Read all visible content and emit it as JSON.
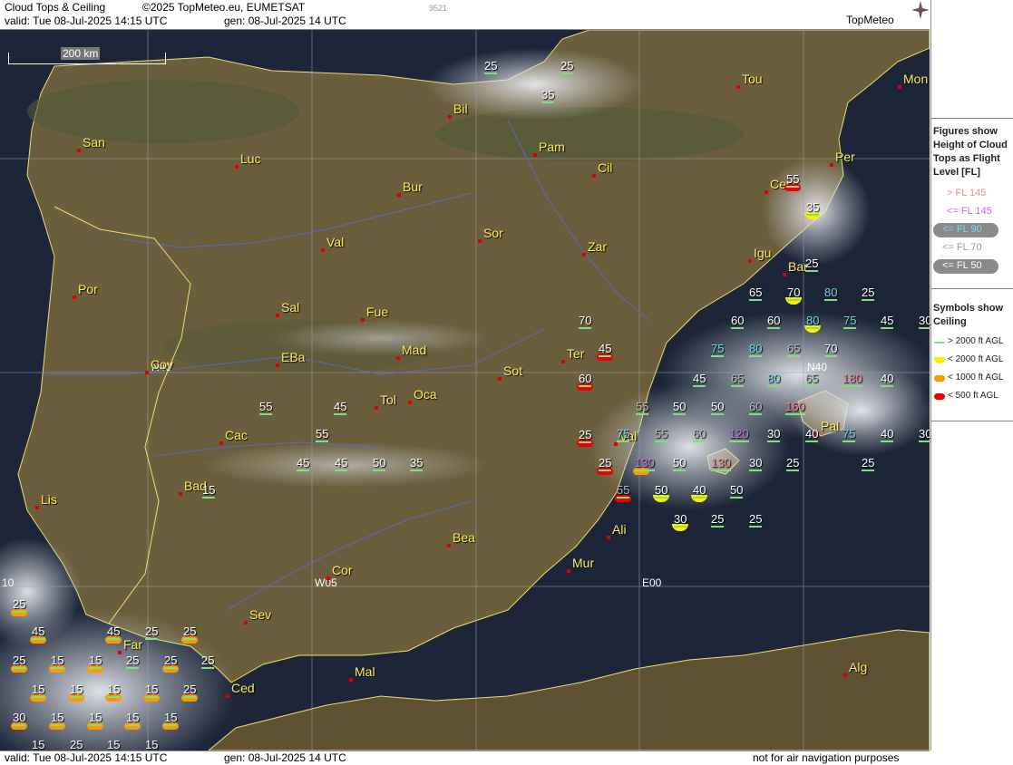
{
  "header": {
    "title": "Cloud Tops & Ceiling",
    "copyright": "©2025 TopMeteo.eu, EUMETSAT",
    "valid": "valid:  Tue   08-Jul-2025   14:15 UTC",
    "gen": "gen:  08-Jul-2025  14 UTC",
    "code": "9521",
    "brand": "TopMeteo"
  },
  "footer": {
    "valid": "valid:  Tue   08-Jul-2025   14:15 UTC",
    "gen": "gen:  08-Jul-2025  14 UTC",
    "note": "not for air navigation purposes"
  },
  "scale_bar": "200 km",
  "grid_labels": {
    "n40_top": "N40",
    "n40_right": "N40",
    "w05": "W05",
    "e00": "E00",
    "w10": "10"
  },
  "legend": {
    "title": "Figures show Height of Cloud Tops as Flight Level  [FL]",
    "items": [
      {
        "label": "> FL 145",
        "color": "#f08a8a"
      },
      {
        "label": "<= FL 145",
        "color": "#c56ee0"
      },
      {
        "label": "<= FL 90",
        "color": "#6fd8f0"
      },
      {
        "label": "<= FL 70",
        "color": "#b8b8b8"
      },
      {
        "label": "<= FL 50",
        "color": "#ffffff"
      }
    ],
    "ceiling_title": "Symbols show Ceiling",
    "ceiling": [
      {
        "label": "> 2000 ft AGL",
        "color": "#7ee07e"
      },
      {
        "label": "< 2000 ft AGL",
        "color": "#ffee00"
      },
      {
        "label": "< 1000 ft AGL",
        "color": "#ff9900"
      },
      {
        "label": "< 500 ft AGL",
        "color": "#ee0000"
      }
    ]
  },
  "cities": [
    "Tou",
    "Mon",
    "Bil",
    "San",
    "Luc",
    "Pam",
    "Cil",
    "Per",
    "Bur",
    "Cer",
    "Val",
    "Sor",
    "Zar",
    "Igu",
    "Bar",
    "Por",
    "Sal",
    "Fue",
    "Mad",
    "Ter",
    "Cov",
    "EBa",
    "Tol",
    "Oca",
    "Sot",
    "Val",
    "Cac",
    "Bad",
    "Lis",
    "Bea",
    "Cor",
    "Mur",
    "Ali",
    "Sev",
    "Far",
    "Ced",
    "Mal",
    "Alg",
    "Pal"
  ],
  "figures": [
    "25",
    "25",
    "35",
    "55",
    "35",
    "25",
    "65",
    "70",
    "80",
    "25",
    "60",
    "60",
    "80",
    "75",
    "45",
    "30",
    "70",
    "45",
    "75",
    "80",
    "65",
    "70",
    "60",
    "45",
    "65",
    "80",
    "65",
    "180",
    "40",
    "55",
    "50",
    "50",
    "60",
    "160",
    "75",
    "55",
    "60",
    "120",
    "30",
    "40",
    "75",
    "40",
    "30",
    "25",
    "25",
    "130",
    "50",
    "130",
    "30",
    "25",
    "25",
    "55",
    "50",
    "40",
    "50",
    "30",
    "25",
    "25",
    "45",
    "55",
    "45",
    "55",
    "45",
    "45",
    "50",
    "35",
    "15",
    "25",
    "45",
    "25",
    "25",
    "25",
    "15",
    "15",
    "25",
    "25",
    "25",
    "15",
    "15",
    "15",
    "15",
    "25",
    "30",
    "15",
    "15",
    "15",
    "15",
    "15",
    "25",
    "15",
    "15"
  ]
}
